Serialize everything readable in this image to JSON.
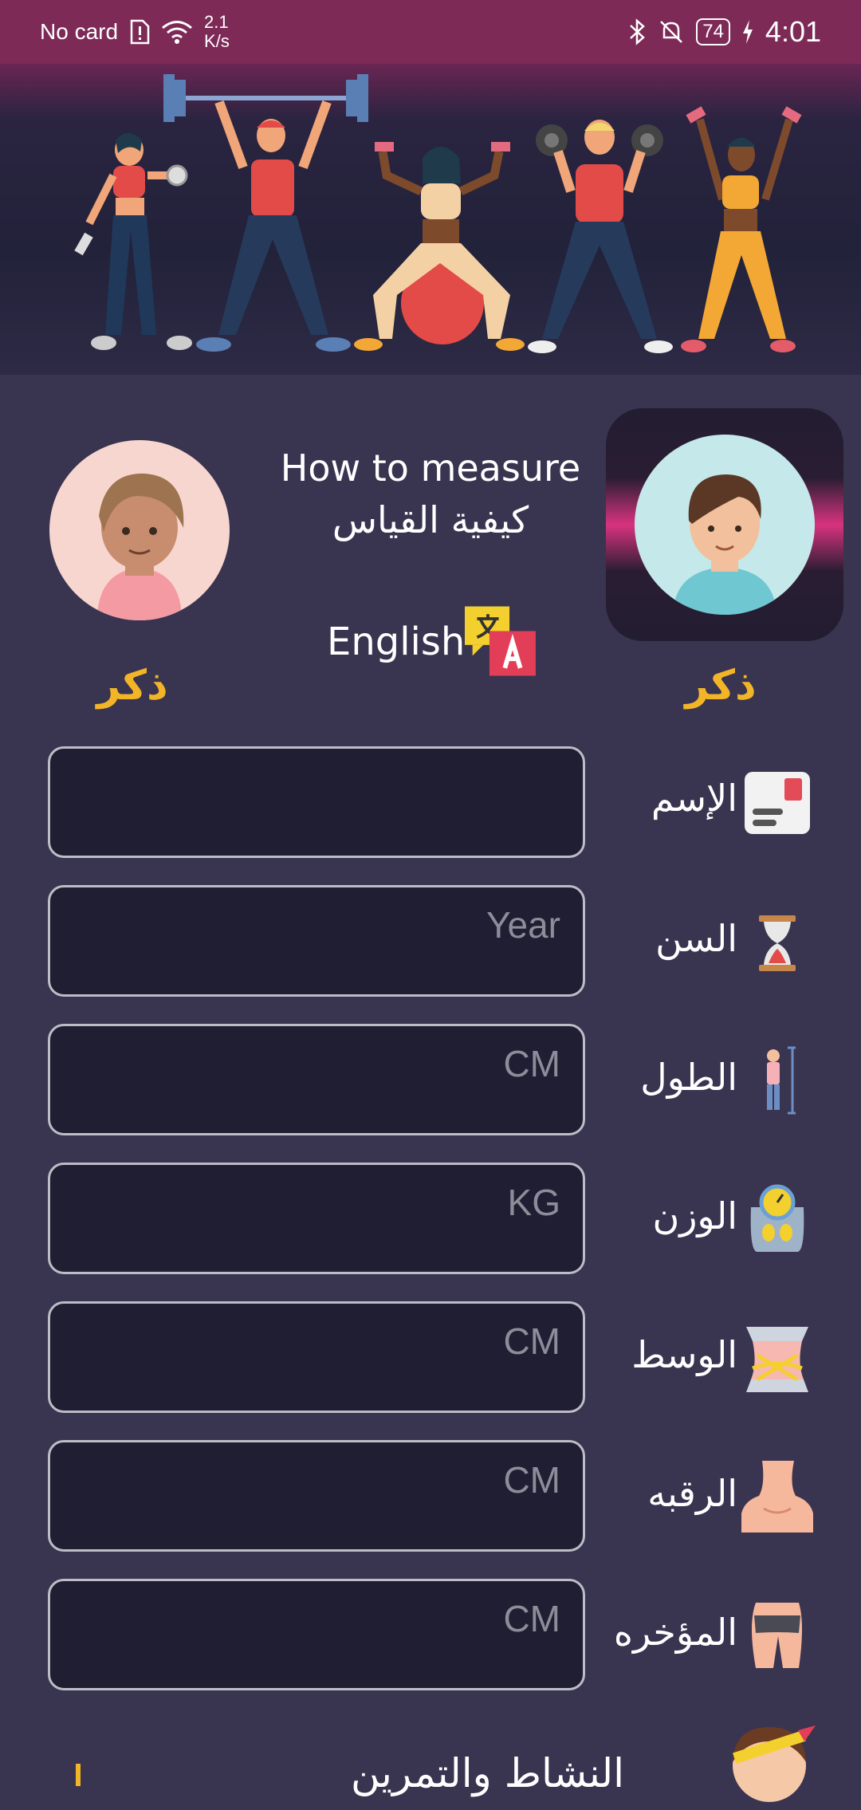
{
  "status_bar": {
    "carrier": "No card",
    "net_speed_value": "2.1",
    "net_speed_unit": "K/s",
    "battery": "74",
    "time": "4:01",
    "icons": [
      "sim-alert-icon",
      "wifi-icon",
      "bluetooth-icon",
      "mute-icon",
      "battery-icon",
      "charging-icon"
    ]
  },
  "header": {
    "title_en": "How to measure",
    "title_ar": "كيفية القياس",
    "language_label": "English",
    "language_icon": "translate-icon"
  },
  "gender": {
    "left_label": "ذكر",
    "right_label": "ذكر",
    "accent_color": "#f3b528"
  },
  "form": {
    "name": {
      "label": "الإسم",
      "placeholder": "",
      "icon": "id-card-icon"
    },
    "age": {
      "label": "السن",
      "placeholder": "Year",
      "icon": "hourglass-icon"
    },
    "height": {
      "label": "الطول",
      "placeholder": "CM",
      "icon": "height-measure-icon"
    },
    "weight": {
      "label": "الوزن",
      "placeholder": "KG",
      "icon": "scale-icon"
    },
    "waist": {
      "label": "الوسط",
      "placeholder": "CM",
      "icon": "waist-tape-icon"
    },
    "neck": {
      "label": "الرقبه",
      "placeholder": "CM",
      "icon": "neck-icon"
    },
    "hip": {
      "label": "المؤخره",
      "placeholder": "CM",
      "icon": "hip-icon"
    }
  },
  "activity": {
    "label": "النشاط والتمرين",
    "icon": "athlete-headband-icon"
  }
}
